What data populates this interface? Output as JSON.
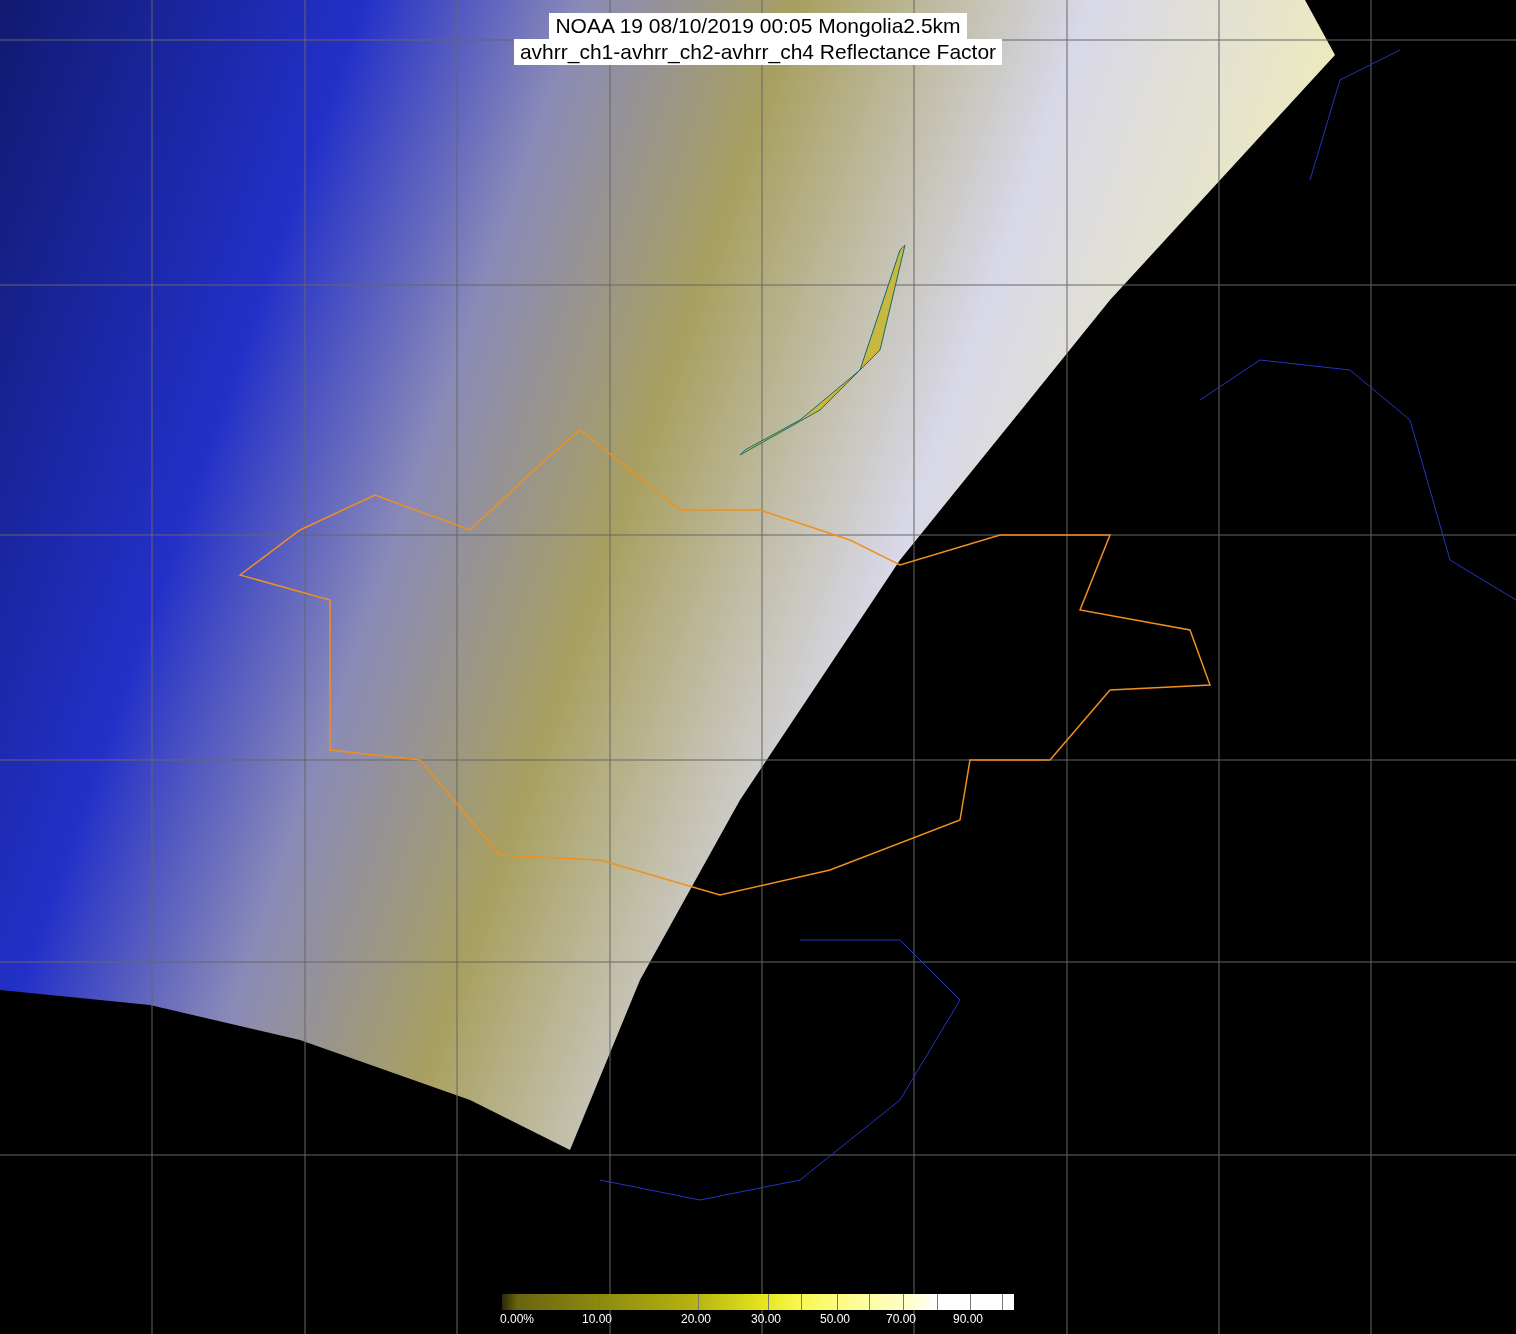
{
  "title": {
    "lines": [
      "NOAA 19 08/10/2019 00:05 Mongolia2.5km",
      "avhrr_ch1-avhrr_ch2-avhrr_ch4 Reflectance Factor"
    ]
  },
  "colorbar": {
    "labels": [
      "0.00%",
      "10.00",
      "20.00",
      "30.00",
      "50.00",
      "70.00",
      "90.00"
    ]
  }
}
